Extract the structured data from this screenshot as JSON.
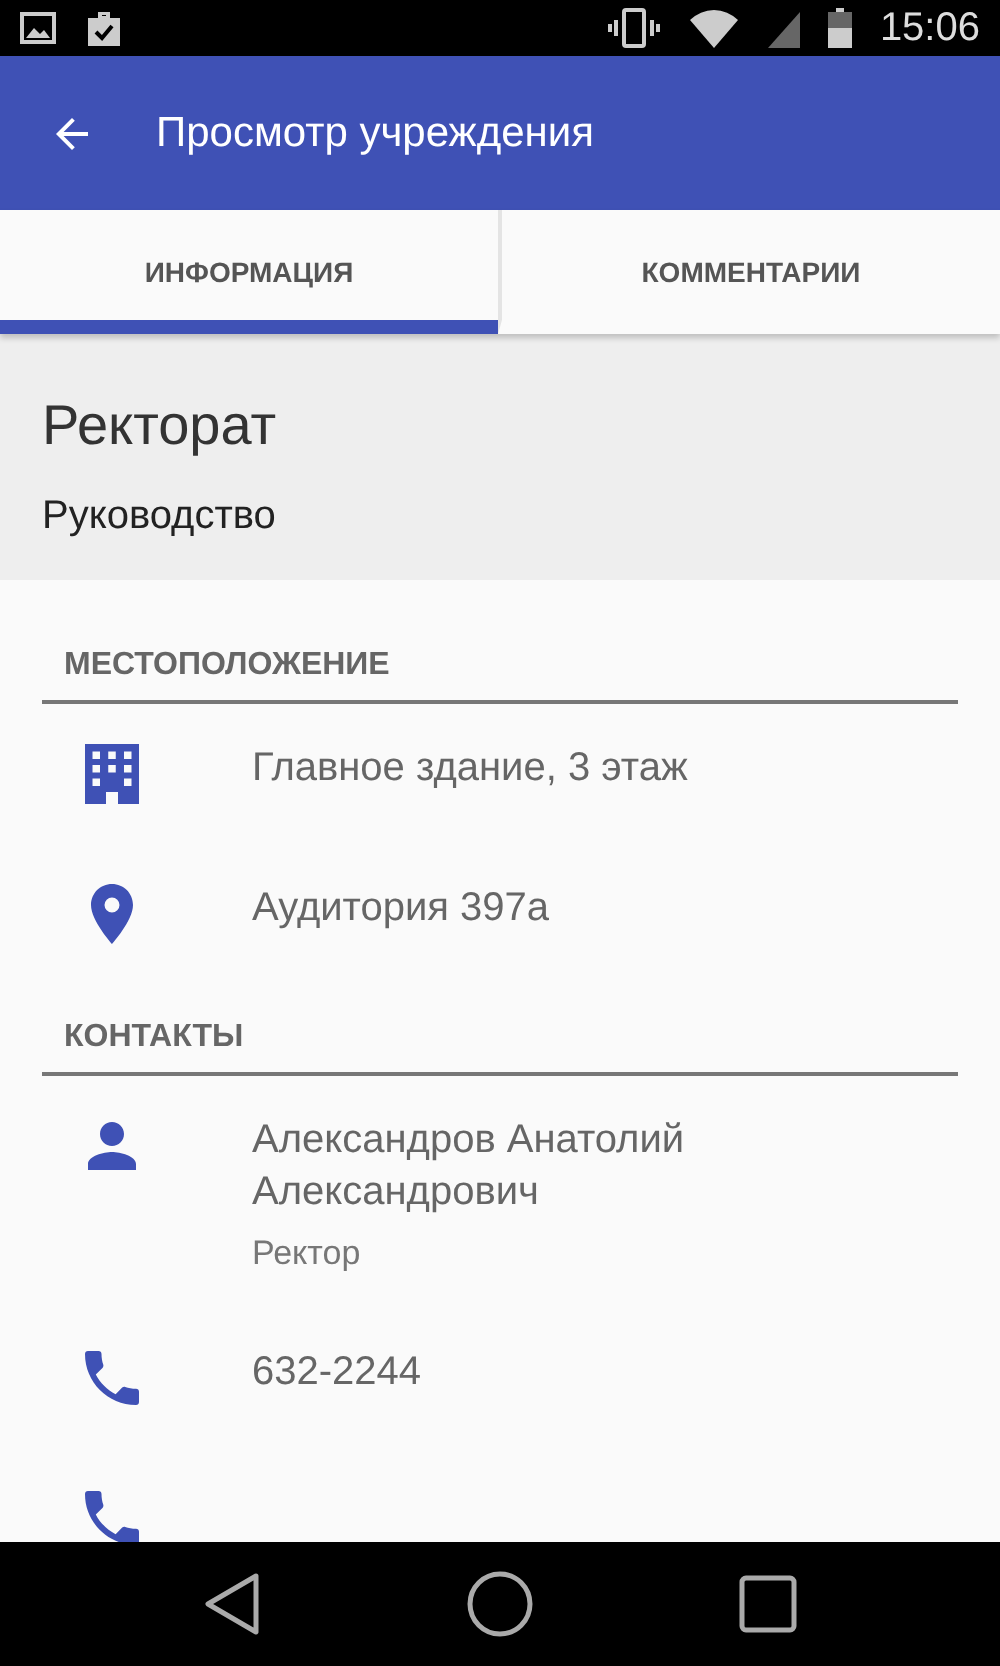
{
  "status_bar": {
    "time": "15:06"
  },
  "app_bar": {
    "title": "Просмотр учреждения"
  },
  "tabs": [
    {
      "label": "ИНФОРМАЦИЯ",
      "selected": true
    },
    {
      "label": "КОММЕНТАРИИ",
      "selected": false
    }
  ],
  "header": {
    "title": "Ректорат",
    "subtitle": "Руководство"
  },
  "sections": [
    {
      "title": "МЕСТОПОЛОЖЕНИЕ",
      "items": [
        {
          "kind": "building",
          "text": "Главное здание, 3 этаж"
        },
        {
          "kind": "pin",
          "text": "Аудитория 397а"
        }
      ]
    },
    {
      "title": "КОНТАКТЫ",
      "items": [
        {
          "kind": "person",
          "text": "Александров Анатолий Александрович",
          "secondary": "Ректор"
        },
        {
          "kind": "phone",
          "text": "632-2244"
        },
        {
          "kind": "phone"
        }
      ]
    }
  ]
}
